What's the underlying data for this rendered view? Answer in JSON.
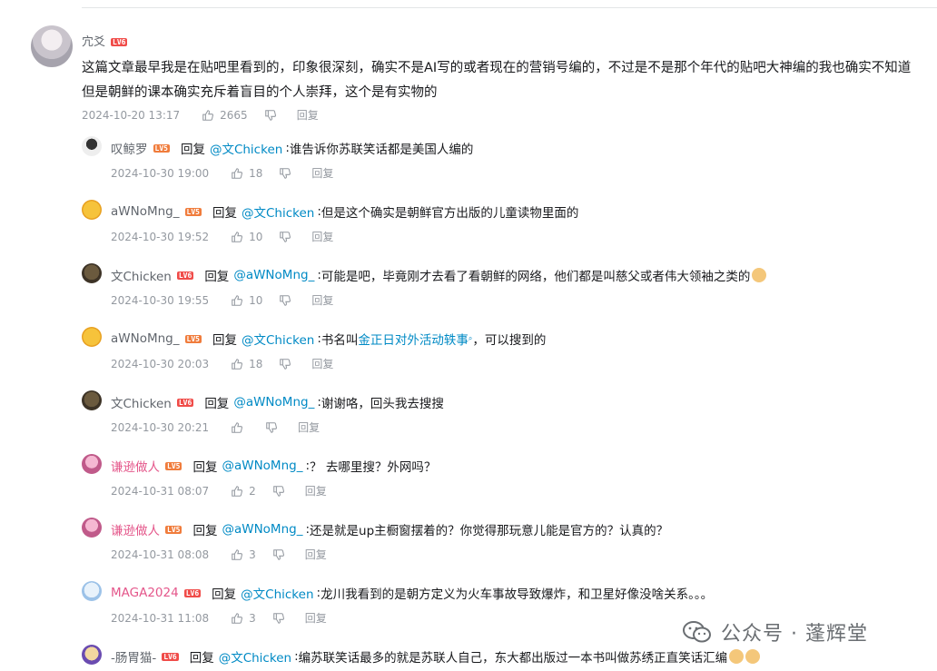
{
  "root": {
    "username": "宂爻",
    "level": "LV6",
    "text_line1": "这篇文章最早我是在贴吧里看到的，印象很深刻，确实不是AI写的或者现在的营销号编的，不过是不是那个年代的贴吧大神编的我也确实不知道",
    "text_line2": "但是朝鲜的课本确实充斥着盲目的个人崇拜，这个是有实物的",
    "time": "2024-10-20 13:17",
    "likes": "2665",
    "reply_label": "回复"
  },
  "replies": [
    {
      "user": "叹鲸罗",
      "level": "LV5",
      "reply_word": "回复",
      "at": "@文Chicken",
      "text": "谁告诉你苏联笑话都是美国人编的",
      "time": "2024-10-30 19:00",
      "likes": "18",
      "reply_label": "回复"
    },
    {
      "user": "aWNoMng_",
      "level": "LV5",
      "reply_word": "回复",
      "at": "@文Chicken",
      "text": "但是这个确实是朝鲜官方出版的儿童读物里面的",
      "time": "2024-10-30 19:52",
      "likes": "10",
      "reply_label": "回复"
    },
    {
      "user": "文Chicken",
      "level": "LV6",
      "reply_word": "回复",
      "at": "@aWNoMng_",
      "text": "可能是吧，毕竟刚才去看了看朝鲜的网络，他们都是叫慈父或者伟大领袖之类的",
      "time": "2024-10-30 19:55",
      "likes": "10",
      "reply_label": "回复"
    },
    {
      "user": "aWNoMng_",
      "level": "LV5",
      "reply_word": "回复",
      "at": "@文Chicken",
      "text_pre": "书名叫",
      "keyword": "金正日对外活动轶事",
      "text_post": "，可以搜到的",
      "time": "2024-10-30 20:03",
      "likes": "18",
      "reply_label": "回复"
    },
    {
      "user": "文Chicken",
      "level": "LV6",
      "reply_word": "回复",
      "at": "@aWNoMng_",
      "text": "谢谢咯，回头我去搜搜",
      "time": "2024-10-30 20:21",
      "likes": "",
      "reply_label": "回复"
    },
    {
      "user": "谦逊做人",
      "level": "LV5",
      "reply_word": "回复",
      "at": "@aWNoMng_",
      "text": "？ 去哪里搜？外网吗？",
      "time": "2024-10-31 08:07",
      "likes": "2",
      "reply_label": "回复"
    },
    {
      "user": "谦逊做人",
      "level": "LV5",
      "reply_word": "回复",
      "at": "@aWNoMng_",
      "text": "还是就是up主橱窗摆着的？你觉得那玩意儿能是官方的？认真的？",
      "time": "2024-10-31 08:08",
      "likes": "3",
      "reply_label": "回复"
    },
    {
      "user": "MAGA2024",
      "level": "LV6",
      "reply_word": "回复",
      "at": "@文Chicken",
      "text": "龙川我看到的是朝方定义为火车事故导致爆炸，和卫星好像没啥关系。。。",
      "time": "2024-10-31 11:08",
      "likes": "3",
      "reply_label": "回复"
    },
    {
      "user": "-肠胃猫-",
      "level": "LV6",
      "reply_word": "回复",
      "at": "@文Chicken",
      "text": "编苏联笑话最多的就是苏联人自己，东大都出版过一本书叫做苏绣正直笑话汇编",
      "time": "",
      "likes": "",
      "reply_label": ""
    }
  ],
  "watermark": {
    "text": "公众号 · 蓬辉堂"
  }
}
